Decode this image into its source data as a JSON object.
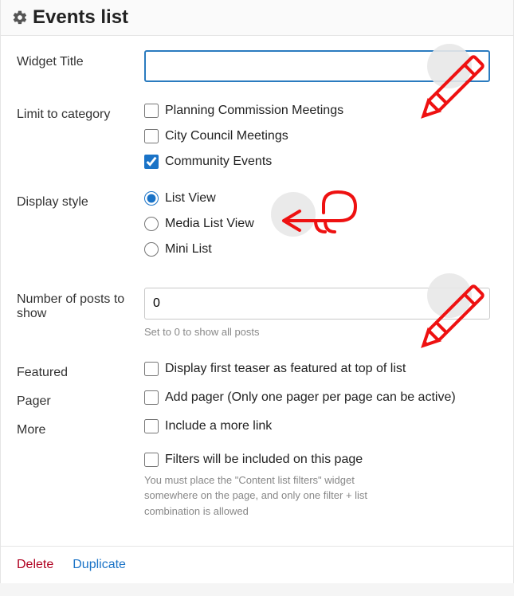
{
  "header": {
    "title": "Events list"
  },
  "fields": {
    "widget_title": {
      "label": "Widget Title",
      "value": ""
    },
    "limit_category": {
      "label": "Limit to category",
      "options": [
        {
          "label": "Planning Commission Meetings",
          "checked": false
        },
        {
          "label": "City Council Meetings",
          "checked": false
        },
        {
          "label": "Community Events",
          "checked": true
        }
      ]
    },
    "display_style": {
      "label": "Display style",
      "options": [
        {
          "label": "List View",
          "selected": true
        },
        {
          "label": "Media List View",
          "selected": false
        },
        {
          "label": "Mini List",
          "selected": false
        }
      ]
    },
    "num_posts": {
      "label": "Number of posts to show",
      "value": "0",
      "help": "Set to 0 to show all posts"
    },
    "featured": {
      "label": "Featured",
      "option_label": "Display first teaser as featured at top of list",
      "checked": false
    },
    "pager": {
      "label": "Pager",
      "option_label": "Add pager (Only one pager per page can be active)",
      "checked": false
    },
    "more": {
      "label": "More",
      "include_label": "Include a more link",
      "include_checked": false,
      "filters_label": "Filters will be included on this page",
      "filters_checked": false,
      "filters_help": "You must place the \"Content list filters\" widget somewhere on the page, and only one filter + list combination is allowed"
    }
  },
  "footer": {
    "delete": "Delete",
    "duplicate": "Duplicate"
  }
}
